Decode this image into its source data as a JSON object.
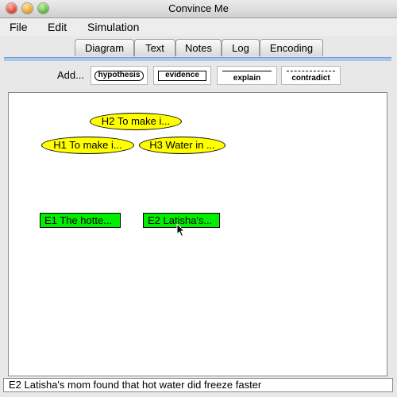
{
  "window": {
    "title": "Convince Me"
  },
  "menu": {
    "items": [
      "File",
      "Edit",
      "Simulation"
    ]
  },
  "tabs": [
    {
      "label": "Diagram",
      "active": false
    },
    {
      "label": "Text",
      "active": false
    },
    {
      "label": "Notes",
      "active": false
    },
    {
      "label": "Log",
      "active": false
    },
    {
      "label": "Encoding",
      "active": false
    }
  ],
  "toolbar": {
    "add_label": "Add...",
    "buttons": {
      "hypothesis": "hypothesis",
      "evidence": "evidence",
      "explain": "explain",
      "contradict": "contradict"
    }
  },
  "diagram": {
    "hypotheses": [
      {
        "label": "H2 To make i..."
      },
      {
        "label": "H1 To make i..."
      },
      {
        "label": "H3 Water in ..."
      }
    ],
    "evidence": [
      {
        "label": "E1 The hotte..."
      },
      {
        "label": "E2 Latisha's..."
      }
    ]
  },
  "status": {
    "text": "E2 Latisha's mom found that hot water did freeze faster"
  },
  "colors": {
    "hypothesis_fill": "#ffff00",
    "evidence_fill": "#00ee00",
    "tab_accent": "#a8c8ee"
  }
}
